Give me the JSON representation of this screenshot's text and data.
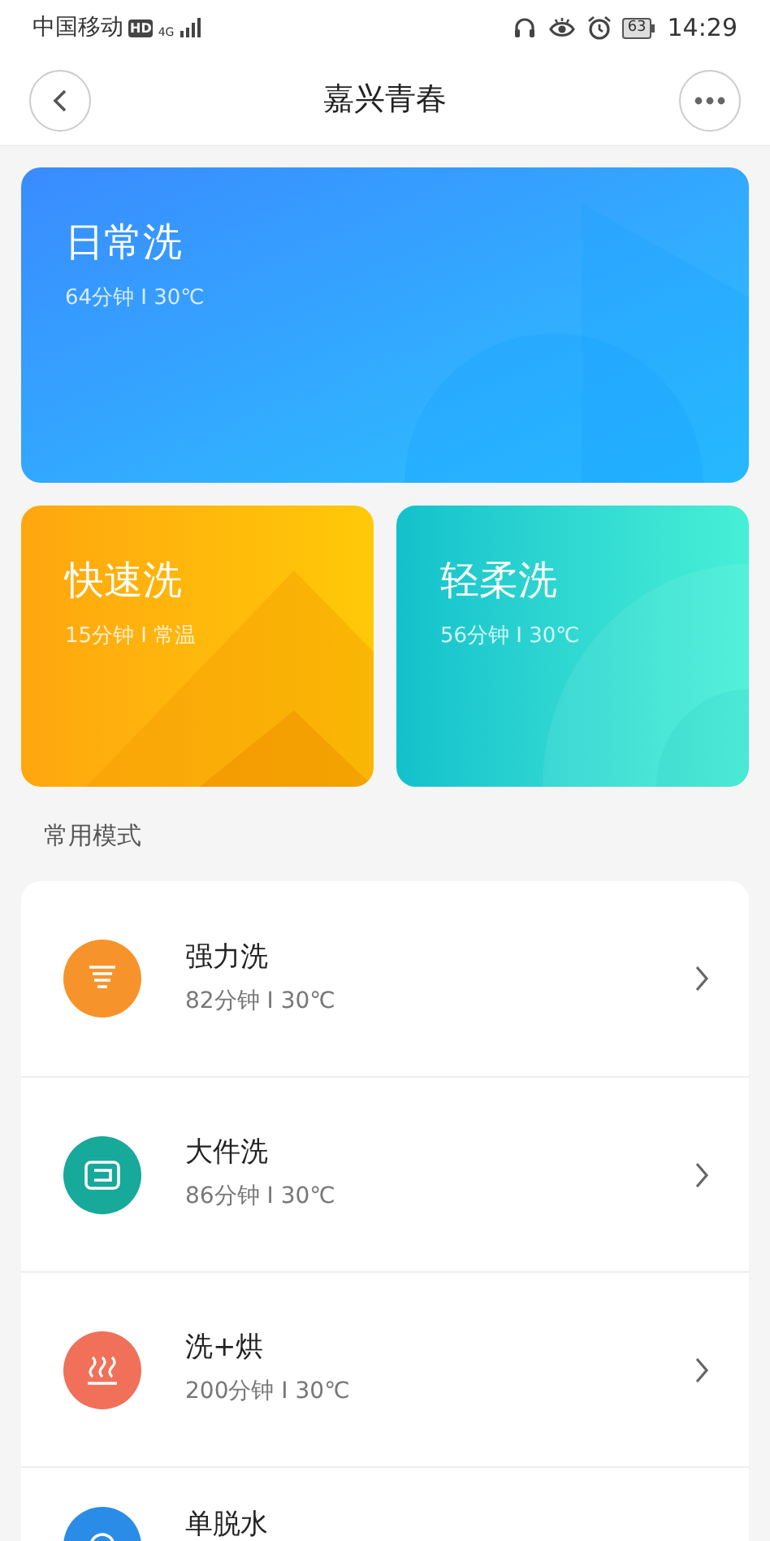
{
  "status_bar": {
    "carrier": "中国移动",
    "hd_badge": "HD",
    "network": "4G",
    "battery": "63",
    "time": "14:29"
  },
  "header": {
    "title": "嘉兴青春"
  },
  "featured_modes": [
    {
      "name": "日常洗",
      "detail": "64分钟 I 30℃",
      "kind": "wide"
    },
    {
      "name": "快速洗",
      "detail": "15分钟 I 常温",
      "kind": "warm"
    },
    {
      "name": "轻柔洗",
      "detail": "56分钟 I 30℃",
      "kind": "cool"
    }
  ],
  "section_title": "常用模式",
  "modes": [
    {
      "name": "强力洗",
      "detail": "82分钟 I 30℃",
      "kind": "funnel",
      "color": "#f7932b"
    },
    {
      "name": "大件洗",
      "detail": "86分钟 I 30℃",
      "kind": "layers",
      "color": "#17a99a"
    },
    {
      "name": "洗+烘",
      "detail": "200分钟 I 30℃",
      "kind": "heat",
      "color": "#f0705a"
    },
    {
      "name": "单脱水",
      "kind": "spin",
      "color": "#2b8ce8"
    }
  ]
}
